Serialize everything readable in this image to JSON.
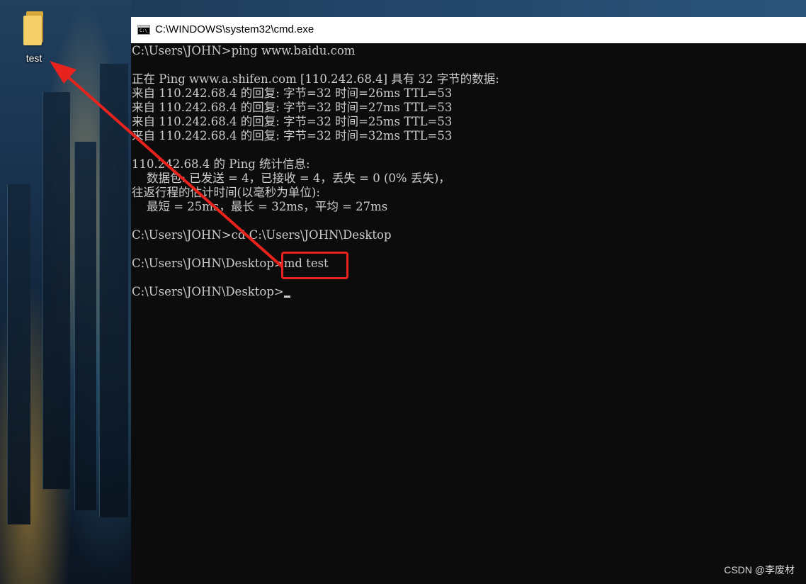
{
  "desktop": {
    "icons": [
      {
        "label": "test",
        "icon": "folder-icon"
      }
    ]
  },
  "window": {
    "title": "C:\\WINDOWS\\system32\\cmd.exe",
    "icon": "cmd-icon",
    "background": "#0c0c0c",
    "text_color": "#cccccc"
  },
  "console": {
    "lines": [
      "C:\\Users\\JOHN>ping www.baidu.com",
      "",
      "正在 Ping www.a.shifen.com [110.242.68.4] 具有 32 字节的数据:",
      "来自 110.242.68.4 的回复: 字节=32 时间=26ms TTL=53",
      "来自 110.242.68.4 的回复: 字节=32 时间=27ms TTL=53",
      "来自 110.242.68.4 的回复: 字节=32 时间=25ms TTL=53",
      "来自 110.242.68.4 的回复: 字节=32 时间=32ms TTL=53",
      "",
      "110.242.68.4 的 Ping 统计信息:",
      "    数据包: 已发送 = 4，已接收 = 4，丢失 = 0 (0% 丢失)，",
      "往返行程的估计时间(以毫秒为单位):",
      "    最短 = 25ms，最长 = 32ms，平均 = 27ms",
      "",
      "C:\\Users\\JOHN>cd C:\\Users\\JOHN\\Desktop",
      "",
      "C:\\Users\\JOHN\\Desktop>md test",
      "",
      "C:\\Users\\JOHN\\Desktop>"
    ]
  },
  "annotation": {
    "color": "#e8221c"
  },
  "watermark": "CSDN @李废材"
}
